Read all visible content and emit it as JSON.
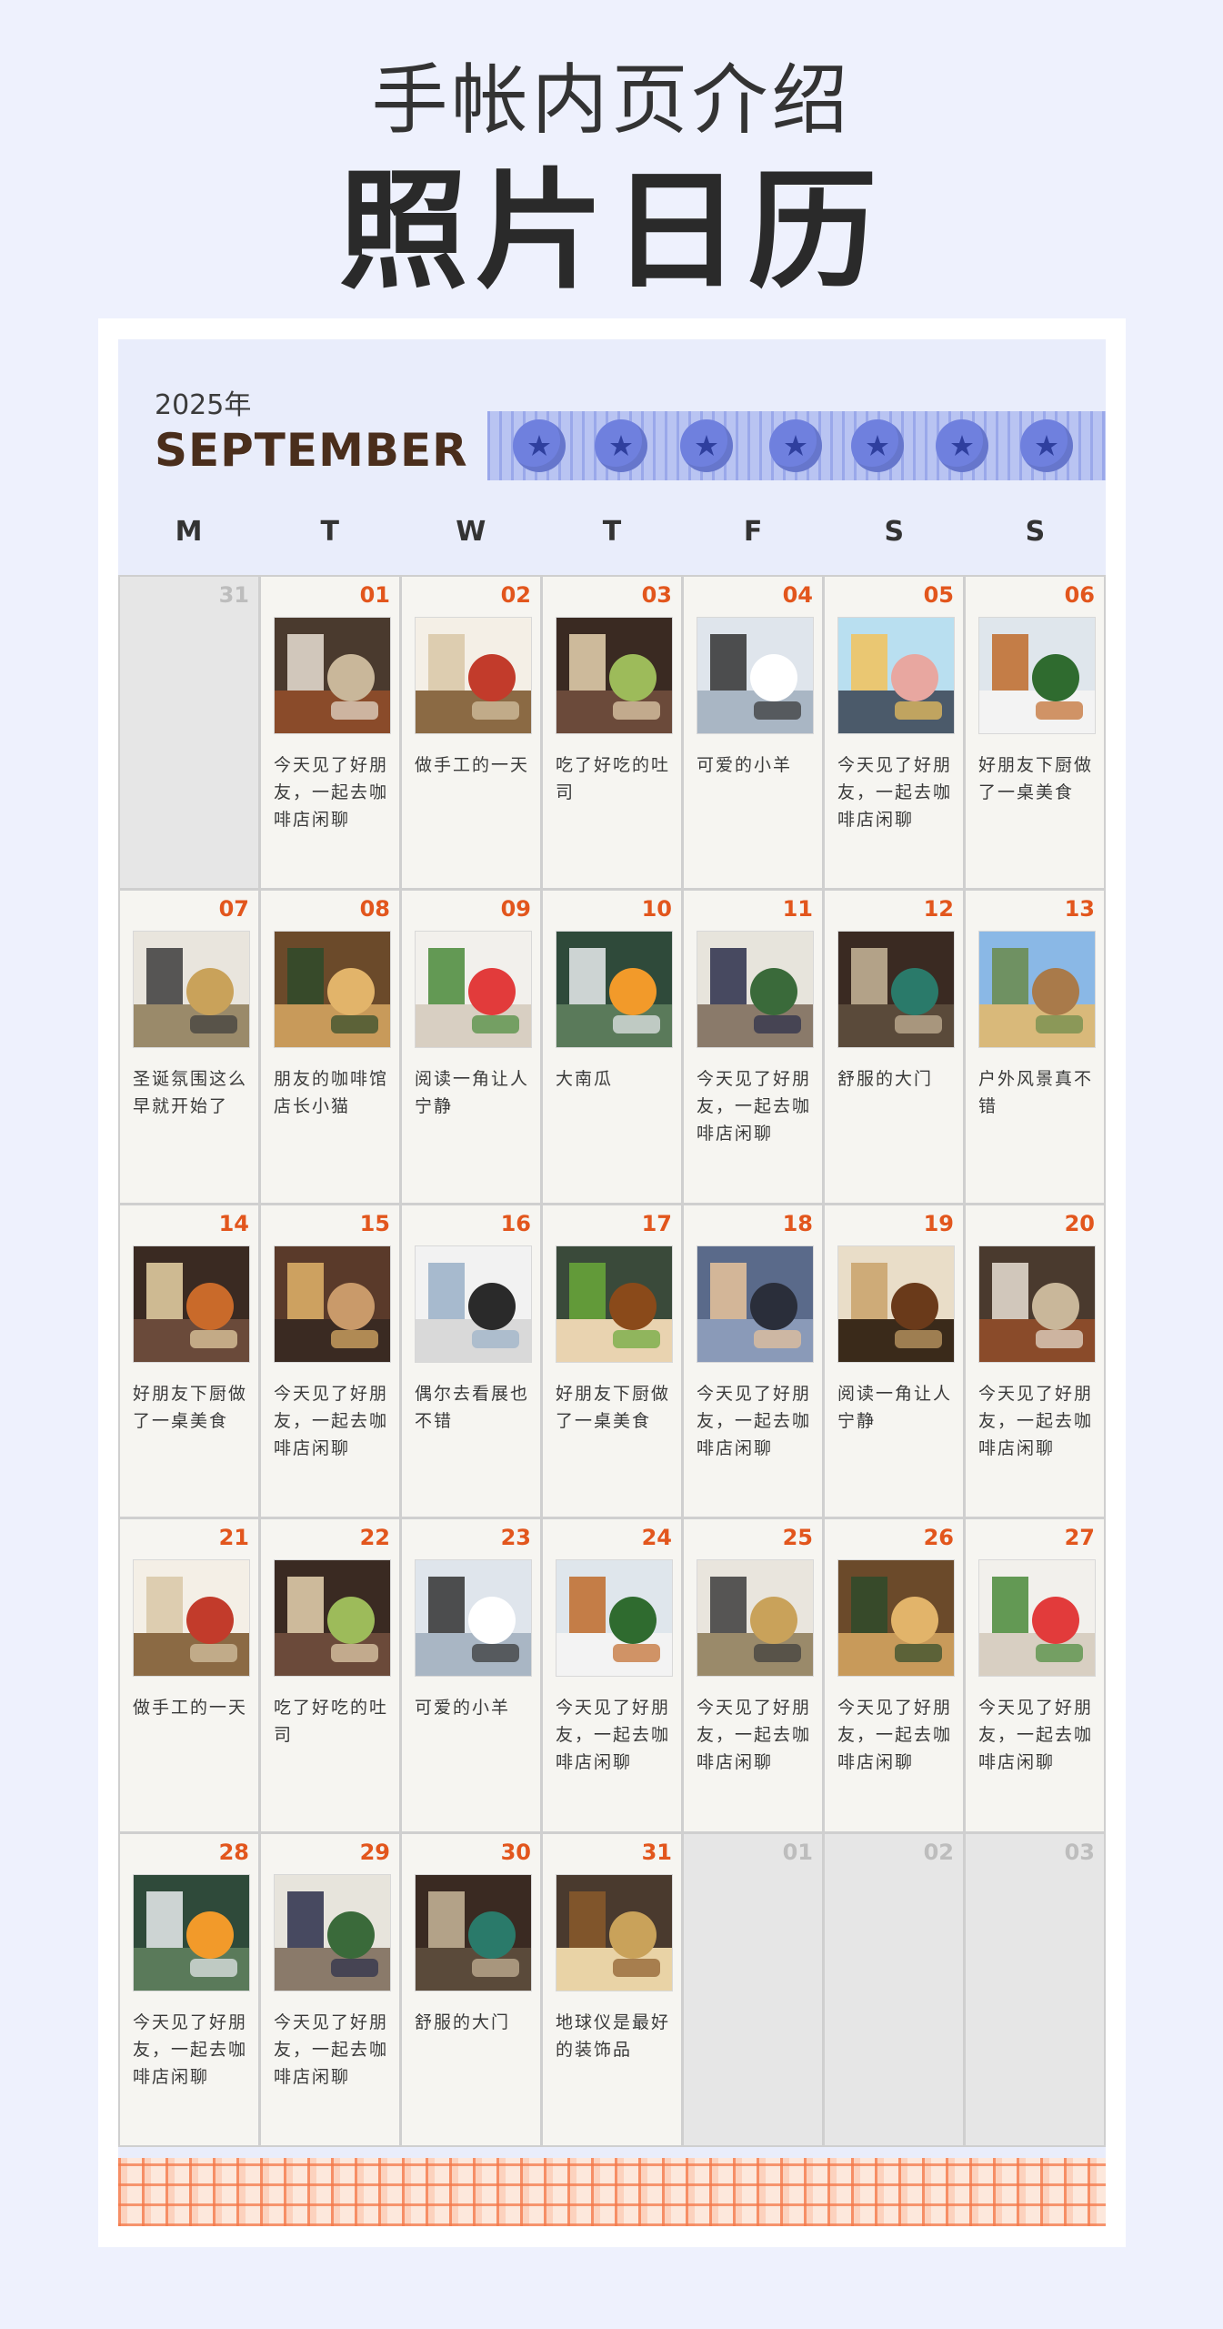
{
  "header": {
    "subtitle": "手帐内页介绍",
    "title": "照片日历"
  },
  "calendar": {
    "year": "2025年",
    "month": "SEPTEMBER",
    "weekdays": [
      "M",
      "T",
      "W",
      "T",
      "F",
      "S",
      "S"
    ],
    "days": [
      {
        "num": "31",
        "note": "",
        "photo": "",
        "out": true
      },
      {
        "num": "01",
        "note": "今天见了好朋友，一起去咖啡店闲聊",
        "photo": "cafe-interior-photo"
      },
      {
        "num": "02",
        "note": "做手工的一天",
        "photo": "handmade-mugs-photo"
      },
      {
        "num": "03",
        "note": "吃了好吃的吐司",
        "photo": "toast-plate-photo"
      },
      {
        "num": "04",
        "note": "可爱的小羊",
        "photo": "sheep-figure-photo"
      },
      {
        "num": "05",
        "note": "今天见了好朋友，一起去咖啡店闲聊",
        "photo": "coffee-table-photo"
      },
      {
        "num": "06",
        "note": "好朋友下厨做了一桌美食",
        "photo": "home-dinner-photo"
      },
      {
        "num": "07",
        "note": "圣诞氛围这么早就开始了",
        "photo": "christmas-kettle-photo"
      },
      {
        "num": "08",
        "note": "朋友的咖啡馆店长小猫",
        "photo": "cafe-cat-photo"
      },
      {
        "num": "09",
        "note": "阅读一角让人宁静",
        "photo": "tulip-vase-photo"
      },
      {
        "num": "10",
        "note": "大南瓜",
        "photo": "pumpkin-photo"
      },
      {
        "num": "11",
        "note": "今天见了好朋友，一起去咖啡店闲聊",
        "photo": "plant-corner-photo"
      },
      {
        "num": "12",
        "note": "舒服的大门",
        "photo": "green-door-photo"
      },
      {
        "num": "13",
        "note": "户外风景真不错",
        "photo": "outdoor-landscape-photo"
      },
      {
        "num": "14",
        "note": "好朋友下厨做了一桌美食",
        "photo": "street-shop-photo"
      },
      {
        "num": "15",
        "note": "今天见了好朋友，一起去咖啡店闲聊",
        "photo": "lattice-window-photo"
      },
      {
        "num": "16",
        "note": "偶尔去看展也不错",
        "photo": "gallery-photo"
      },
      {
        "num": "17",
        "note": "好朋友下厨做了一桌美食",
        "photo": "roast-dish-photo"
      },
      {
        "num": "18",
        "note": "今天见了好朋友，一起去咖啡店闲聊",
        "photo": "dusk-street-photo"
      },
      {
        "num": "19",
        "note": "阅读一角让人宁静",
        "photo": "dining-room-photo"
      },
      {
        "num": "20",
        "note": "今天见了好朋友，一起去咖啡店闲聊",
        "photo": "cafe-interior-photo"
      },
      {
        "num": "21",
        "note": "做手工的一天",
        "photo": "handmade-mugs-photo"
      },
      {
        "num": "22",
        "note": "吃了好吃的吐司",
        "photo": "toast-plate-photo"
      },
      {
        "num": "23",
        "note": "可爱的小羊",
        "photo": "sheep-figure-photo"
      },
      {
        "num": "24",
        "note": "今天见了好朋友，一起去咖啡店闲聊",
        "photo": "home-dinner-photo"
      },
      {
        "num": "25",
        "note": "今天见了好朋友，一起去咖啡店闲聊",
        "photo": "christmas-kettle-photo"
      },
      {
        "num": "26",
        "note": "今天见了好朋友，一起去咖啡店闲聊",
        "photo": "cafe-cat-photo"
      },
      {
        "num": "27",
        "note": "今天见了好朋友，一起去咖啡店闲聊",
        "photo": "tulip-vase-photo"
      },
      {
        "num": "28",
        "note": "今天见了好朋友，一起去咖啡店闲聊",
        "photo": "pumpkin-photo"
      },
      {
        "num": "29",
        "note": "今天见了好朋友，一起去咖啡店闲聊",
        "photo": "plant-corner-photo"
      },
      {
        "num": "30",
        "note": "舒服的大门",
        "photo": "green-door-photo"
      },
      {
        "num": "31",
        "note": "地球仪是最好的装饰品",
        "photo": "globe-desk-photo"
      },
      {
        "num": "01",
        "note": "",
        "photo": "",
        "out": true
      },
      {
        "num": "02",
        "note": "",
        "photo": "",
        "out": true
      },
      {
        "num": "03",
        "note": "",
        "photo": "",
        "out": true
      }
    ]
  },
  "decorations": {
    "blueberry_icon": "blueberry-icon",
    "blueberry_count": 7,
    "plaid_icon": "orange-plaid-ribbon"
  },
  "colors": {
    "background": "#eef1fd",
    "accent_date": "#e2561d",
    "month_text": "#4a2e1c",
    "blueberry": "#6f80de",
    "plaid": "#f47848"
  }
}
